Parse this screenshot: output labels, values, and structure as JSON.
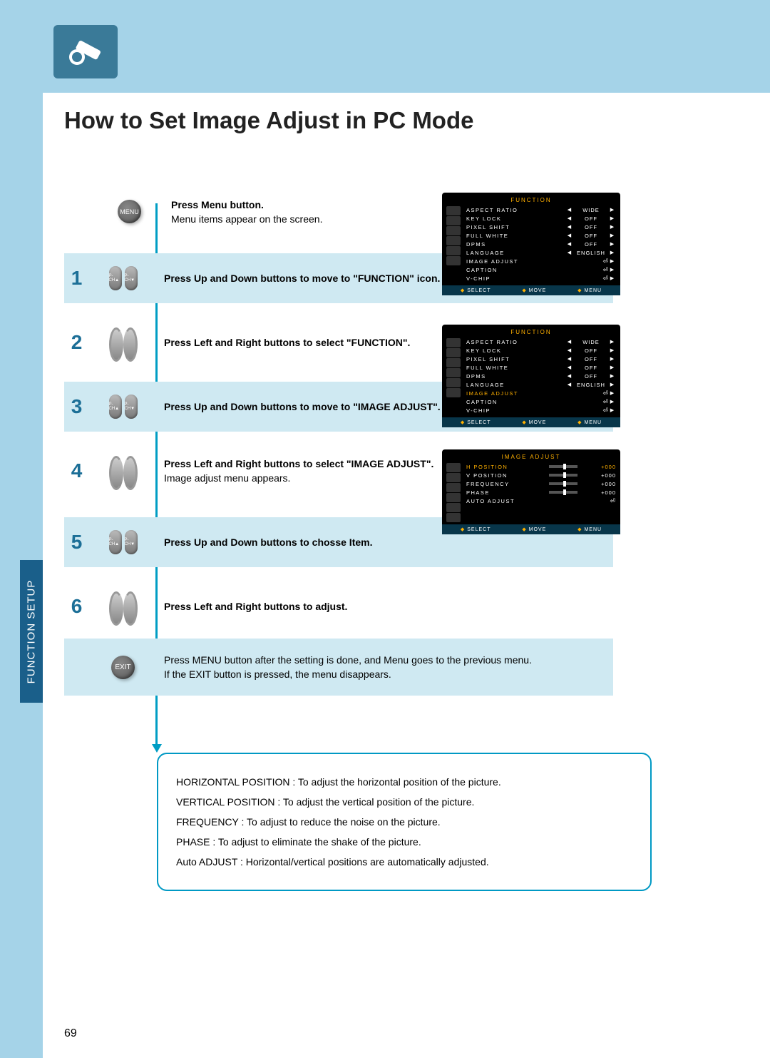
{
  "title": "How to Set Image Adjust in PC Mode",
  "side_tab": "FUNCTION SETUP",
  "page_number": "69",
  "menu_label": "MENU",
  "exit_label": "EXIT",
  "pch_up": "P-CH▲",
  "pch_dn": "P-CH▼",
  "step0": {
    "bold": "Press Menu button.",
    "plain": "Menu items appear on the screen."
  },
  "steps": [
    {
      "num": "1",
      "bold": "Press Up and Down buttons to move to \"FUNCTION\" icon.",
      "plain": "",
      "band": true,
      "icons": "updown"
    },
    {
      "num": "2",
      "bold": "Press Left and Right buttons to select \"FUNCTION\".",
      "plain": "",
      "band": false,
      "icons": "leftright"
    },
    {
      "num": "3",
      "bold": "Press Up and Down buttons to move to \"IMAGE ADJUST\".",
      "plain": "",
      "band": true,
      "icons": "updown"
    },
    {
      "num": "4",
      "bold": "Press Left and Right buttons to select \"IMAGE ADJUST\".",
      "plain": "Image adjust menu appears.",
      "band": false,
      "icons": "leftright"
    },
    {
      "num": "5",
      "bold": "Press Up and Down buttons to chosse Item.",
      "plain": "",
      "band": true,
      "icons": "updown"
    },
    {
      "num": "6",
      "bold": "Press Left and Right buttons to adjust.",
      "plain": "",
      "band": false,
      "icons": "leftright"
    }
  ],
  "exit_text": {
    "line1": "Press MENU button after the setting is done, and Menu goes to the previous menu.",
    "line2": "If the EXIT button is pressed, the menu disappears."
  },
  "notes": [
    "HORIZONTAL POSITION : To adjust the horizontal position of the picture.",
    "VERTICAL POSITION : To adjust the vertical position of the picture.",
    "FREQUENCY : To adjust to reduce the noise on the picture.",
    "PHASE : To adjust to eliminate the shake of the picture.",
    "Auto ADJUST : Horizontal/vertical positions are automatically adjusted."
  ],
  "osd_function": {
    "header": "FUNCTION",
    "rows": [
      {
        "lbl": "ASPECT RATIO",
        "val": "WIDE",
        "arrows": true
      },
      {
        "lbl": "KEY LOCK",
        "val": "OFF",
        "arrows": true
      },
      {
        "lbl": "PIXEL SHIFT",
        "val": "OFF",
        "arrows": true
      },
      {
        "lbl": "FULL WHITE",
        "val": "OFF",
        "arrows": true
      },
      {
        "lbl": "DPMS",
        "val": "OFF",
        "arrows": true
      },
      {
        "lbl": "LANGUAGE",
        "val": "ENGLISH",
        "arrows": true
      },
      {
        "lbl": "IMAGE ADJUST",
        "val": "",
        "enter": true
      },
      {
        "lbl": "CAPTION",
        "val": "",
        "enter": true
      },
      {
        "lbl": "V-CHIP",
        "val": "",
        "enter": true
      }
    ],
    "foot": {
      "select": "SELECT",
      "move": "MOVE",
      "menu": "MENU"
    }
  },
  "osd_image": {
    "header": "IMAGE ADJUST",
    "rows": [
      {
        "lbl": "H POSITION",
        "val": "+000",
        "bar": true,
        "hl": true
      },
      {
        "lbl": "V POSITION",
        "val": "+000",
        "bar": true
      },
      {
        "lbl": "FREQUENCY",
        "val": "+000",
        "bar": true
      },
      {
        "lbl": "PHASE",
        "val": "+000",
        "bar": true
      },
      {
        "lbl": "AUTO ADJUST",
        "val": "",
        "enter": true
      }
    ],
    "foot": {
      "select": "SELECT",
      "move": "MOVE",
      "menu": "MENU"
    }
  }
}
